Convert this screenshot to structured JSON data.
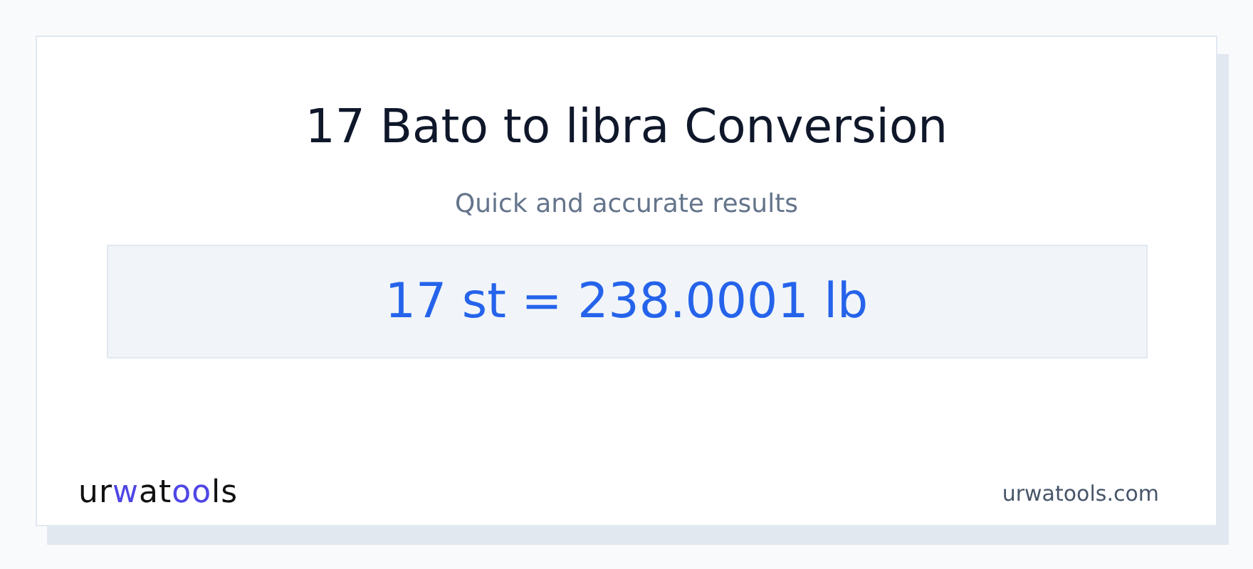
{
  "title": "17 Bato to libra Conversion",
  "subtitle": "Quick and accurate results",
  "result": "17 st = 238.0001 lb",
  "logo": [
    {
      "text": "ur",
      "accent": false
    },
    {
      "text": "w",
      "accent": true
    },
    {
      "text": "at",
      "accent": false
    },
    {
      "text": "oo",
      "accent": true
    },
    {
      "text": "ls",
      "accent": false
    }
  ],
  "site": "urwatools.com"
}
